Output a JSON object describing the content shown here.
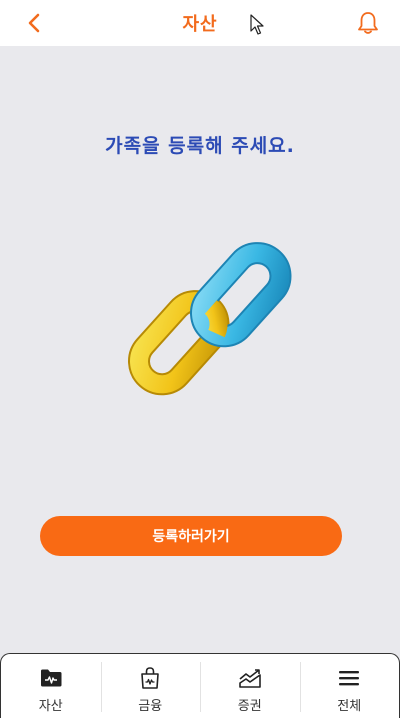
{
  "header": {
    "title": "자산",
    "back_icon": "chevron-left-icon",
    "bell_icon": "bell-icon",
    "accent_color": "#f26b1d"
  },
  "main": {
    "headline": "가족을 등록해 주세요.",
    "illustration": "chain-link-icon",
    "cta_label": "등록하러가기",
    "cta_color": "#f96a14"
  },
  "tabbar": {
    "items": [
      {
        "label": "자산",
        "icon": "wallet-icon"
      },
      {
        "label": "금융",
        "icon": "shopping-bag-icon"
      },
      {
        "label": "증권",
        "icon": "stock-chart-icon"
      },
      {
        "label": "전체",
        "icon": "menu-icon"
      }
    ]
  }
}
